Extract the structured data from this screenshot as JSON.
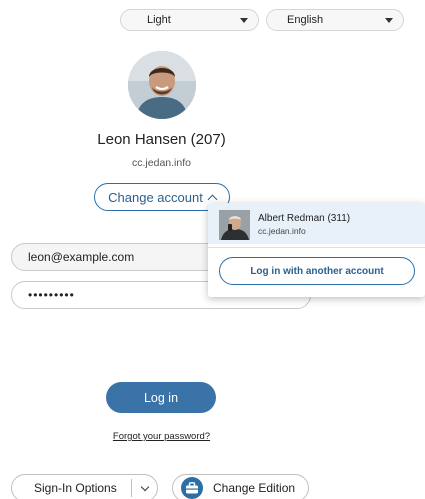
{
  "top_bar": {
    "theme_select": {
      "value": "Light"
    },
    "language_select": {
      "value": "English"
    }
  },
  "user": {
    "name": "Leon Hansen (207)",
    "domain": "cc.jedan.info"
  },
  "change_account_label": "Change account",
  "account_popup": {
    "accounts": [
      {
        "name": "Albert Redman (311)",
        "domain": "cc.jedan.info"
      }
    ],
    "another_account_label": "Log in with another account"
  },
  "login_form": {
    "email_value": "leon@example.com",
    "password_value": "•••••••••"
  },
  "login_button_label": "Log in",
  "forgot_password_label": "Forgot your password?",
  "footer": {
    "signin_options_label": "Sign-In Options",
    "change_edition_label": "Change Edition"
  },
  "colors": {
    "accent": "#3a73a8",
    "popup_highlight": "#e8f1f9"
  }
}
